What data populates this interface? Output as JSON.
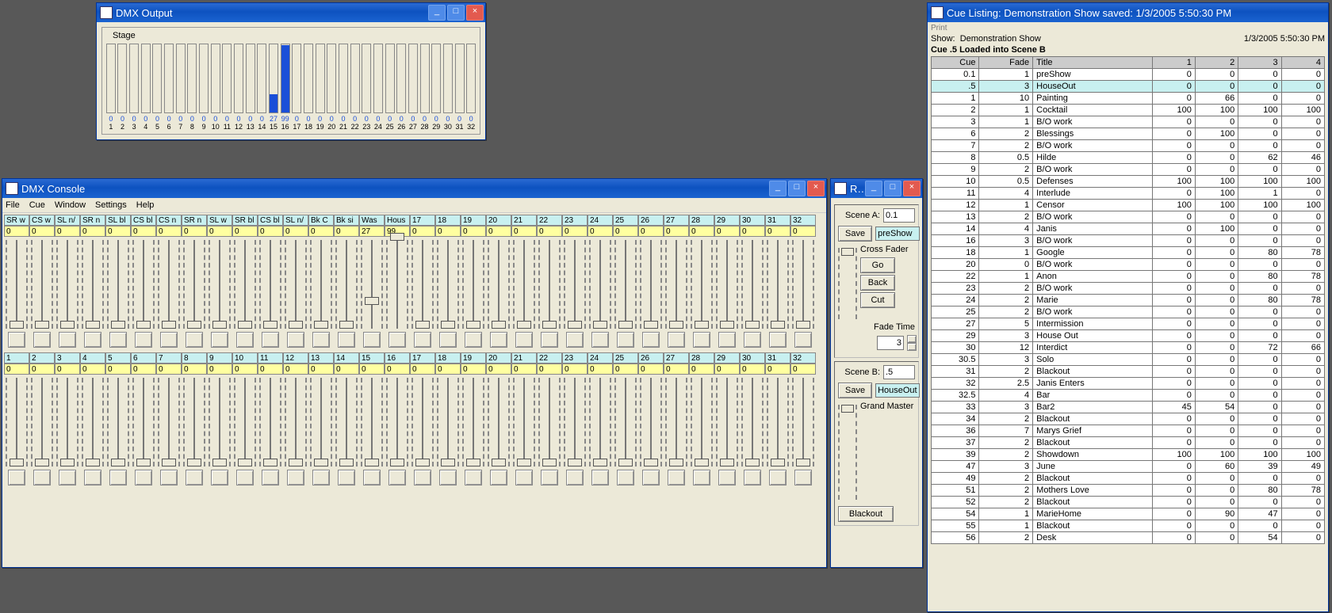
{
  "dmx_output": {
    "title": "DMX Output",
    "frame_label": "Stage",
    "channels": [
      {
        "n": 1,
        "v": 0
      },
      {
        "n": 2,
        "v": 0
      },
      {
        "n": 3,
        "v": 0
      },
      {
        "n": 4,
        "v": 0
      },
      {
        "n": 5,
        "v": 0
      },
      {
        "n": 6,
        "v": 0
      },
      {
        "n": 7,
        "v": 0
      },
      {
        "n": 8,
        "v": 0
      },
      {
        "n": 9,
        "v": 0
      },
      {
        "n": 10,
        "v": 0
      },
      {
        "n": 11,
        "v": 0
      },
      {
        "n": 12,
        "v": 0
      },
      {
        "n": 13,
        "v": 0
      },
      {
        "n": 14,
        "v": 0
      },
      {
        "n": 15,
        "v": 27
      },
      {
        "n": 16,
        "v": 99
      },
      {
        "n": 17,
        "v": 0
      },
      {
        "n": 18,
        "v": 0
      },
      {
        "n": 19,
        "v": 0
      },
      {
        "n": 20,
        "v": 0
      },
      {
        "n": 21,
        "v": 0
      },
      {
        "n": 22,
        "v": 0
      },
      {
        "n": 23,
        "v": 0
      },
      {
        "n": 24,
        "v": 0
      },
      {
        "n": 25,
        "v": 0
      },
      {
        "n": 26,
        "v": 0
      },
      {
        "n": 27,
        "v": 0
      },
      {
        "n": 28,
        "v": 0
      },
      {
        "n": 29,
        "v": 0
      },
      {
        "n": 30,
        "v": 0
      },
      {
        "n": 31,
        "v": 0
      },
      {
        "n": 32,
        "v": 0
      }
    ]
  },
  "dmx_console": {
    "title": "DMX Console",
    "menus": [
      "File",
      "Cue",
      "Window",
      "Settings",
      "Help"
    ],
    "sceneA": {
      "labels": [
        "SR w",
        "CS w",
        "SL n/",
        "SR n",
        "SL bl",
        "CS bl",
        "CS n",
        "SR n",
        "SL w",
        "SR bl",
        "CS bl",
        "SL n/",
        "Bk C",
        "Bk si",
        "Was",
        "Hous",
        "17",
        "18",
        "19",
        "20",
        "21",
        "22",
        "23",
        "24",
        "25",
        "26",
        "27",
        "28",
        "29",
        "30",
        "31",
        "32"
      ],
      "values": [
        0,
        0,
        0,
        0,
        0,
        0,
        0,
        0,
        0,
        0,
        0,
        0,
        0,
        0,
        27,
        99,
        0,
        0,
        0,
        0,
        0,
        0,
        0,
        0,
        0,
        0,
        0,
        0,
        0,
        0,
        0,
        0
      ]
    },
    "sceneB": {
      "labels": [
        "1",
        "2",
        "3",
        "4",
        "5",
        "6",
        "7",
        "8",
        "9",
        "10",
        "11",
        "12",
        "13",
        "14",
        "15",
        "16",
        "17",
        "18",
        "19",
        "20",
        "21",
        "22",
        "23",
        "24",
        "25",
        "26",
        "27",
        "28",
        "29",
        "30",
        "31",
        "32"
      ],
      "values": [
        0,
        0,
        0,
        0,
        0,
        0,
        0,
        0,
        0,
        0,
        0,
        0,
        0,
        0,
        0,
        0,
        0,
        0,
        0,
        0,
        0,
        0,
        0,
        0,
        0,
        0,
        0,
        0,
        0,
        0,
        0,
        0
      ]
    }
  },
  "run_panel": {
    "title": "Ru...",
    "sceneA_label": "Scene A:",
    "sceneA_value": "0.1",
    "sceneA_name": "preShow",
    "sceneB_label": "Scene B:",
    "sceneB_value": ".5",
    "sceneB_name": "HouseOut",
    "save_label": "Save",
    "cross_fader_label": "Cross Fader",
    "go_label": "Go",
    "back_label": "Back",
    "cut_label": "Cut",
    "fade_time_label": "Fade Time",
    "fade_time_value": "3",
    "grand_master_label": "Grand Master",
    "blackout_label": "Blackout"
  },
  "cue_listing": {
    "title": "Cue Listing: Demonstration Show saved: 1/3/2005 5:50:30 PM",
    "print": "Print",
    "show_label": "Show:",
    "show_name": "Demonstration Show",
    "timestamp": "1/3/2005 5:50:30 PM",
    "loaded": "Cue .5 Loaded into Scene B",
    "columns": [
      "Cue",
      "Fade",
      "Title",
      "1",
      "2",
      "3",
      "4"
    ],
    "highlight_cue": ".5",
    "rows": [
      {
        "cue": "0.1",
        "fade": "1",
        "title": "preShow",
        "v": [
          0,
          0,
          0,
          0
        ]
      },
      {
        "cue": ".5",
        "fade": "3",
        "title": "HouseOut",
        "v": [
          0,
          0,
          0,
          0
        ]
      },
      {
        "cue": "1",
        "fade": "10",
        "title": "Painting",
        "v": [
          0,
          66,
          0,
          0
        ]
      },
      {
        "cue": "2",
        "fade": "1",
        "title": "Cocktail",
        "v": [
          100,
          100,
          100,
          100
        ]
      },
      {
        "cue": "3",
        "fade": "1",
        "title": "B/O work",
        "v": [
          0,
          0,
          0,
          0
        ]
      },
      {
        "cue": "6",
        "fade": "2",
        "title": "Blessings",
        "v": [
          0,
          100,
          0,
          0
        ]
      },
      {
        "cue": "7",
        "fade": "2",
        "title": "B/O work",
        "v": [
          0,
          0,
          0,
          0
        ]
      },
      {
        "cue": "8",
        "fade": "0.5",
        "title": "Hilde",
        "v": [
          0,
          0,
          62,
          46
        ]
      },
      {
        "cue": "9",
        "fade": "2",
        "title": "B/O work",
        "v": [
          0,
          0,
          0,
          0
        ]
      },
      {
        "cue": "10",
        "fade": "0.5",
        "title": "Defenses",
        "v": [
          100,
          100,
          100,
          100
        ]
      },
      {
        "cue": "11",
        "fade": "4",
        "title": "Interlude",
        "v": [
          0,
          100,
          1,
          0
        ]
      },
      {
        "cue": "12",
        "fade": "1",
        "title": "Censor",
        "v": [
          100,
          100,
          100,
          100
        ]
      },
      {
        "cue": "13",
        "fade": "2",
        "title": "B/O work",
        "v": [
          0,
          0,
          0,
          0
        ]
      },
      {
        "cue": "14",
        "fade": "4",
        "title": "Janis",
        "v": [
          0,
          100,
          0,
          0
        ]
      },
      {
        "cue": "16",
        "fade": "3",
        "title": "B/O work",
        "v": [
          0,
          0,
          0,
          0
        ]
      },
      {
        "cue": "18",
        "fade": "1",
        "title": "Google",
        "v": [
          0,
          0,
          80,
          78
        ]
      },
      {
        "cue": "20",
        "fade": "0",
        "title": "B/O work",
        "v": [
          0,
          0,
          0,
          0
        ]
      },
      {
        "cue": "22",
        "fade": "1",
        "title": "Anon",
        "v": [
          0,
          0,
          80,
          78
        ]
      },
      {
        "cue": "23",
        "fade": "2",
        "title": "B/O work",
        "v": [
          0,
          0,
          0,
          0
        ]
      },
      {
        "cue": "24",
        "fade": "2",
        "title": "Marie",
        "v": [
          0,
          0,
          80,
          78
        ]
      },
      {
        "cue": "25",
        "fade": "2",
        "title": "B/O work",
        "v": [
          0,
          0,
          0,
          0
        ]
      },
      {
        "cue": "27",
        "fade": "5",
        "title": "Intermission",
        "v": [
          0,
          0,
          0,
          0
        ]
      },
      {
        "cue": "29",
        "fade": "3",
        "title": "House Out",
        "v": [
          0,
          0,
          0,
          0
        ]
      },
      {
        "cue": "30",
        "fade": "12",
        "title": "Interdict",
        "v": [
          0,
          0,
          72,
          66
        ]
      },
      {
        "cue": "30.5",
        "fade": "3",
        "title": "Solo",
        "v": [
          0,
          0,
          0,
          0
        ]
      },
      {
        "cue": "31",
        "fade": "2",
        "title": "Blackout",
        "v": [
          0,
          0,
          0,
          0
        ]
      },
      {
        "cue": "32",
        "fade": "2.5",
        "title": "Janis Enters",
        "v": [
          0,
          0,
          0,
          0
        ]
      },
      {
        "cue": "32.5",
        "fade": "4",
        "title": "Bar",
        "v": [
          0,
          0,
          0,
          0
        ]
      },
      {
        "cue": "33",
        "fade": "3",
        "title": "Bar2",
        "v": [
          45,
          54,
          0,
          0
        ]
      },
      {
        "cue": "34",
        "fade": "2",
        "title": "Blackout",
        "v": [
          0,
          0,
          0,
          0
        ]
      },
      {
        "cue": "36",
        "fade": "7",
        "title": "Marys Grief",
        "v": [
          0,
          0,
          0,
          0
        ]
      },
      {
        "cue": "37",
        "fade": "2",
        "title": "Blackout",
        "v": [
          0,
          0,
          0,
          0
        ]
      },
      {
        "cue": "39",
        "fade": "2",
        "title": "Showdown",
        "v": [
          100,
          100,
          100,
          100
        ]
      },
      {
        "cue": "47",
        "fade": "3",
        "title": "June",
        "v": [
          0,
          60,
          39,
          49
        ]
      },
      {
        "cue": "49",
        "fade": "2",
        "title": "Blackout",
        "v": [
          0,
          0,
          0,
          0
        ]
      },
      {
        "cue": "51",
        "fade": "2",
        "title": "Mothers Love",
        "v": [
          0,
          0,
          80,
          78
        ]
      },
      {
        "cue": "52",
        "fade": "2",
        "title": "Blackout",
        "v": [
          0,
          0,
          0,
          0
        ]
      },
      {
        "cue": "54",
        "fade": "1",
        "title": "MarieHome",
        "v": [
          0,
          90,
          47,
          0
        ]
      },
      {
        "cue": "55",
        "fade": "1",
        "title": "Blackout",
        "v": [
          0,
          0,
          0,
          0
        ]
      },
      {
        "cue": "56",
        "fade": "2",
        "title": "Desk",
        "v": [
          0,
          0,
          54,
          0
        ]
      }
    ]
  }
}
